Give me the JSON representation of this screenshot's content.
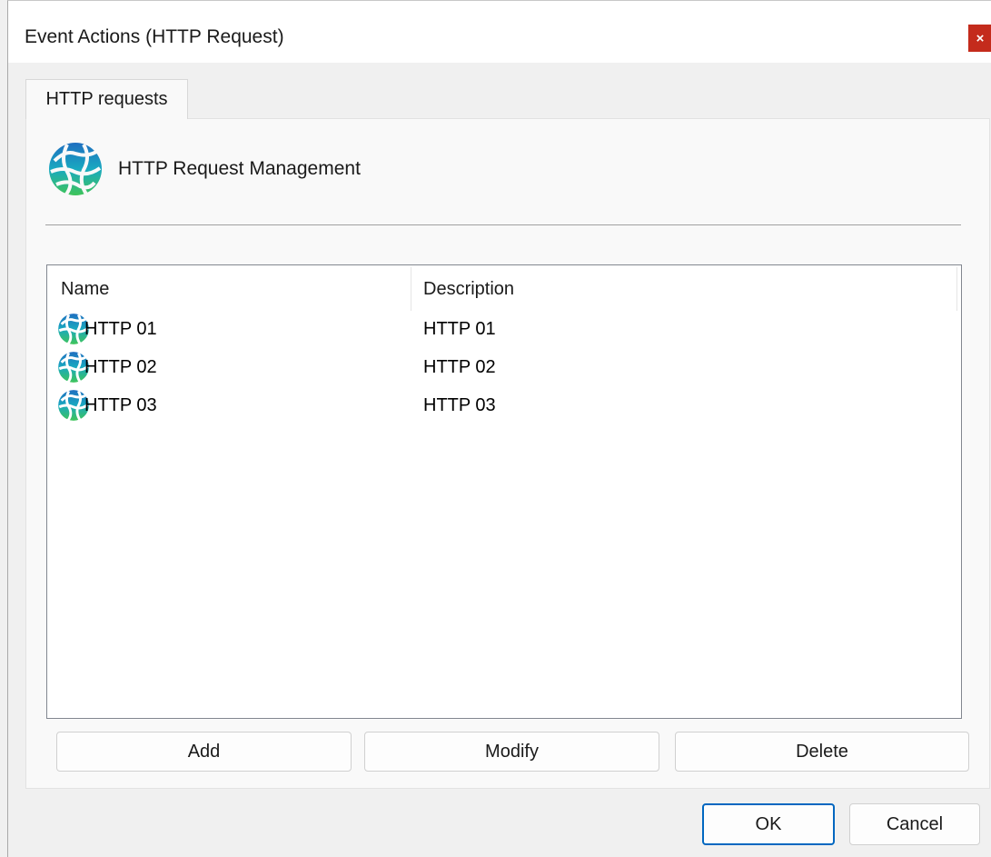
{
  "window": {
    "title": "Event Actions (HTTP Request)",
    "close_glyph": "×"
  },
  "tabs": [
    {
      "label": "HTTP requests",
      "active": true
    }
  ],
  "header": {
    "icon": "globe-icon",
    "label": "HTTP Request Management"
  },
  "list": {
    "columns": [
      "Name",
      "Description"
    ],
    "rows": [
      {
        "icon": "globe-icon",
        "name": "HTTP 01",
        "description": "HTTP 01"
      },
      {
        "icon": "globe-icon",
        "name": "HTTP 02",
        "description": "HTTP 02"
      },
      {
        "icon": "globe-icon",
        "name": "HTTP 03",
        "description": "HTTP 03"
      }
    ]
  },
  "actions": {
    "add_label": "Add",
    "modify_label": "Modify",
    "delete_label": "Delete"
  },
  "footer": {
    "ok_label": "OK",
    "cancel_label": "Cancel"
  },
  "colors": {
    "close_button": "#c42b1c",
    "default_button_border": "#0067c0",
    "icon_blue": "#1f7fc4",
    "icon_teal": "#19b59e",
    "icon_green": "#3fc45a"
  }
}
